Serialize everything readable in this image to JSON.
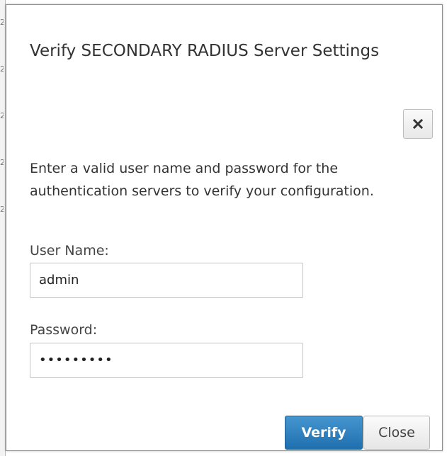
{
  "dialog": {
    "title": "Verify SECONDARY RADIUS Server Settings",
    "description": "Enter a valid user name and password for the authentication servers to verify your configuration.",
    "close_icon": "close-icon"
  },
  "form": {
    "username_label": "User Name:",
    "username_value": "admin",
    "password_label": "Password:",
    "password_value": "•••••••••"
  },
  "buttons": {
    "verify_label": "Verify",
    "close_label": "Close"
  },
  "colors": {
    "primary": "#2a7dbd",
    "text": "#333333"
  }
}
